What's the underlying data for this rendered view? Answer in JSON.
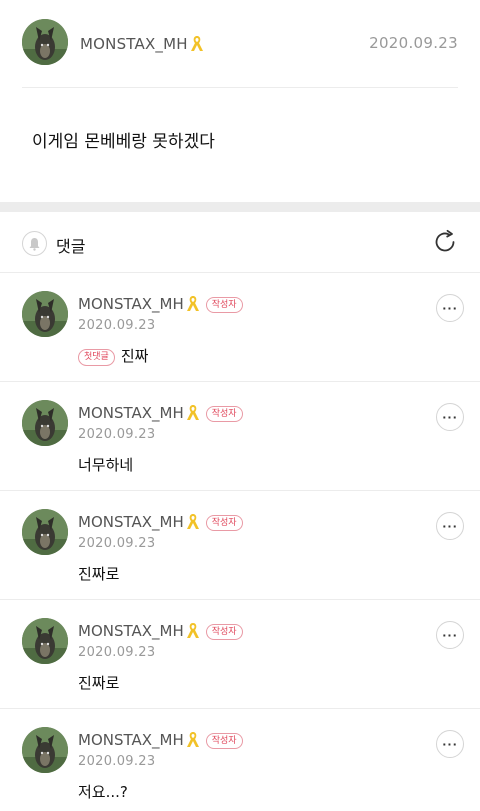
{
  "post": {
    "author": "MONSTAX_MH",
    "date": "2020.09.23",
    "body": "이게임 몬베베랑 못하겠다"
  },
  "comments_section": {
    "title": "댓글"
  },
  "icons": {
    "ribbon": "yellow-ribbon-icon",
    "bell": "bell-icon",
    "refresh": "refresh-icon",
    "more": "more-icon"
  },
  "colors": {
    "accent_red": "#e0485c",
    "ribbon_yellow": "#f2c228"
  },
  "comments": [
    {
      "author": "MONSTAX_MH",
      "badge": "작성자",
      "date": "2020.09.23",
      "first_badge": "첫댓글",
      "text": "진짜",
      "more": "···"
    },
    {
      "author": "MONSTAX_MH",
      "badge": "작성자",
      "date": "2020.09.23",
      "text": "너무하네",
      "more": "···"
    },
    {
      "author": "MONSTAX_MH",
      "badge": "작성자",
      "date": "2020.09.23",
      "text": "진짜로",
      "more": "···"
    },
    {
      "author": "MONSTAX_MH",
      "badge": "작성자",
      "date": "2020.09.23",
      "text": "진짜로",
      "more": "···"
    },
    {
      "author": "MONSTAX_MH",
      "badge": "작성자",
      "date": "2020.09.23",
      "text": "저요...?",
      "more": "···"
    }
  ]
}
